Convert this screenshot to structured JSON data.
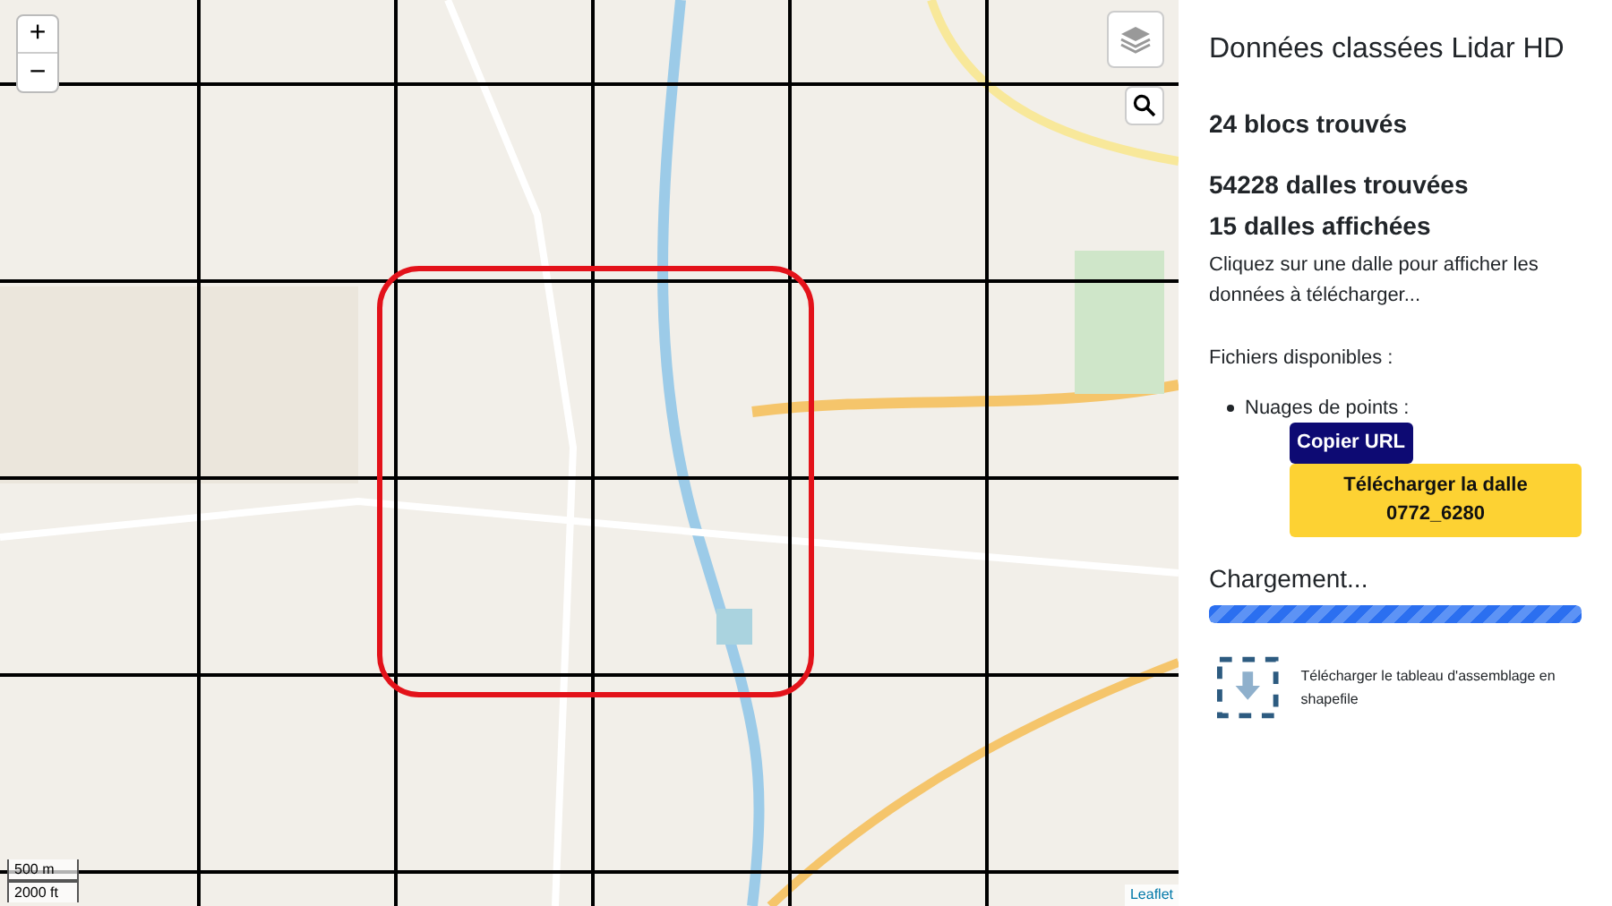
{
  "map": {
    "zoom_in": "+",
    "zoom_out": "−",
    "scale": [
      "500 m",
      "2000 ft"
    ],
    "attribution": "Leaflet"
  },
  "panel": {
    "title": "Données classées Lidar HD",
    "blocks": "24 blocs trouvés",
    "tiles_found": "54228 dalles trouvées",
    "tiles_shown": "15 dalles affichées",
    "hint": "Cliquez sur une dalle pour afficher les données à télécharger...",
    "files_label": "Fichiers disponibles :",
    "files": [
      {
        "label": "Nuages de points :",
        "copy_button": "Copier URL",
        "download_button": "Télécharger la dalle 0772_6280"
      }
    ],
    "loading": {
      "label": "Chargement...",
      "level": 1
    },
    "assembly_link": "Télécharger le tableau d'assemblage en shapefile"
  }
}
